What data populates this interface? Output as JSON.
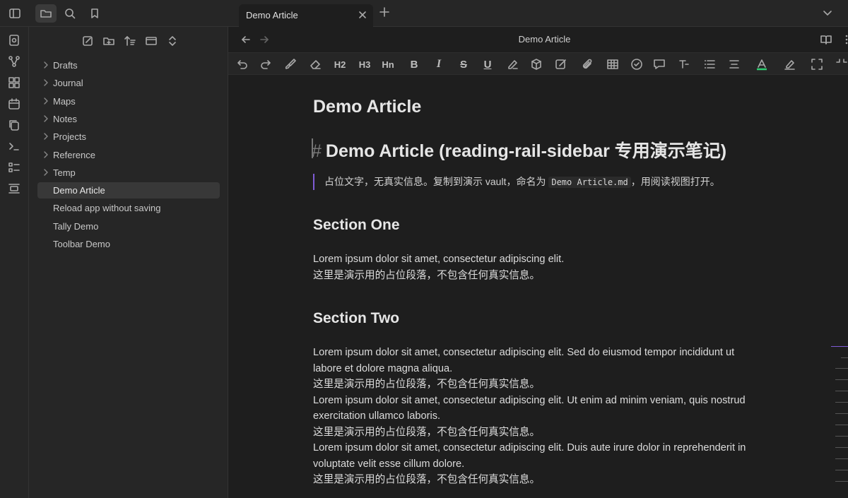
{
  "tab": {
    "title": "Demo Article"
  },
  "view": {
    "title": "Demo Article"
  },
  "explorer": {
    "items": [
      {
        "label": "Drafts",
        "folder": true
      },
      {
        "label": "Journal",
        "folder": true
      },
      {
        "label": "Maps",
        "folder": true
      },
      {
        "label": "Notes",
        "folder": true
      },
      {
        "label": "Projects",
        "folder": true
      },
      {
        "label": "Reference",
        "folder": true
      },
      {
        "label": "Temp",
        "folder": true
      },
      {
        "label": "Demo Article",
        "folder": false,
        "active": true
      },
      {
        "label": "Reload app without saving",
        "folder": false
      },
      {
        "label": "Tally Demo",
        "folder": false
      },
      {
        "label": "Toolbar Demo",
        "folder": false
      }
    ]
  },
  "toolbar": {
    "h2": "H2",
    "h3": "H3",
    "hn": "Hn",
    "bold": "B",
    "italic": "I",
    "strike": "S",
    "underline": "U"
  },
  "colors": {
    "accent": "#7f5bd5",
    "text_color_underline": "#2ecc71"
  },
  "note": {
    "inline_title": "Demo Article",
    "h1_hash": "#",
    "h1": "Demo Article (reading-rail-sidebar 专用演示笔记)",
    "quote_before": "占位文字，无真实信息。复制到演示 vault，命名为 ",
    "quote_code": "Demo Article.md",
    "quote_after": "，用阅读视图打开。",
    "section_one": "Section One",
    "s1_line1": "Lorem ipsum dolor sit amet, consectetur adipiscing elit.",
    "s1_line2": "这里是演示用的占位段落，不包含任何真实信息。",
    "section_two": "Section Two",
    "s2_p1": "Lorem ipsum dolor sit amet, consectetur adipiscing elit. Sed do eiusmod tempor incididunt ut labore et dolore magna aliqua.",
    "s2_p1_cn": "这里是演示用的占位段落，不包含任何真实信息。",
    "s2_p2": "Lorem ipsum dolor sit amet, consectetur adipiscing elit. Ut enim ad minim veniam, quis nostrud exercitation ullamco laboris.",
    "s2_p2_cn": "这里是演示用的占位段落，不包含任何真实信息。",
    "s2_p3": "Lorem ipsum dolor sit amet, consectetur adipiscing elit. Duis aute irure dolor in reprehenderit in voluptate velit esse cillum dolore.",
    "s2_p3_cn": "这里是演示用的占位段落，不包含任何真实信息。"
  }
}
